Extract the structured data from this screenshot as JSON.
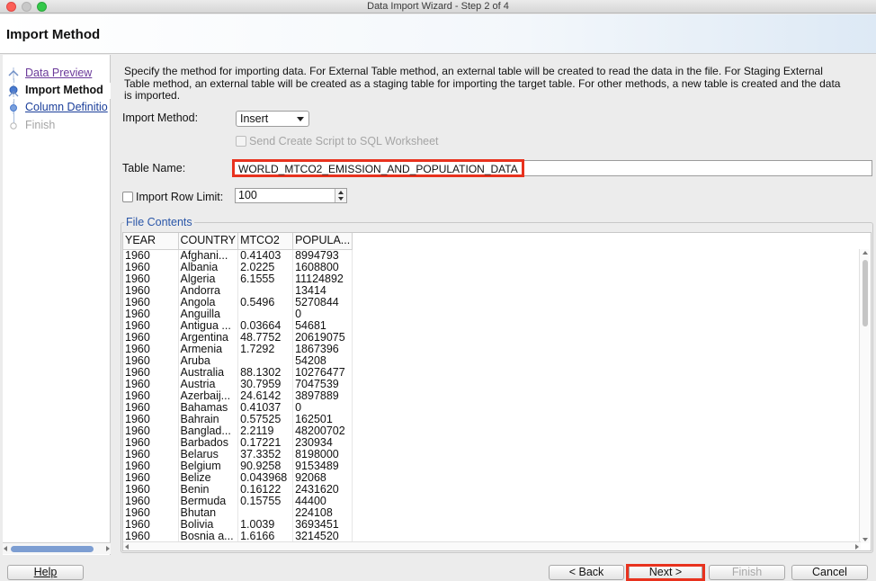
{
  "window": {
    "title": "Data Import Wizard - Step 2 of 4"
  },
  "header": {
    "title": "Import Method"
  },
  "steps": [
    {
      "label": "Data Preview",
      "state": "visited"
    },
    {
      "label": "Import Method",
      "state": "current"
    },
    {
      "label": "Column Definitio",
      "state": "link"
    },
    {
      "label": "Finish",
      "state": "disabled"
    }
  ],
  "description": "Specify the method for importing data.  For External Table method, an external table will be created to read the data in the file.  For Staging External Table method, an external table will be created as a staging table for importing the target table.  For other methods, a new table is created and the data is imported.",
  "form": {
    "import_method_label": "Import Method:",
    "import_method_value": "Insert",
    "send_script_label": "Send Create Script to SQL Worksheet",
    "table_name_label": "Table Name:",
    "table_name_value": "WORLD_MTCO2_EMISSION_AND_POPULATION_DATA",
    "import_row_limit_label": "Import Row Limit:",
    "import_row_limit_value": "100"
  },
  "file_contents": {
    "title": "File Contents",
    "columns": [
      "YEAR",
      "COUNTRY",
      "MTCO2",
      "POPULA..."
    ],
    "rows": [
      [
        "1960",
        "Afghani...",
        "0.41403",
        "8994793"
      ],
      [
        "1960",
        "Albania",
        "2.0225",
        "1608800"
      ],
      [
        "1960",
        "Algeria",
        "6.1555",
        "11124892"
      ],
      [
        "1960",
        "Andorra",
        "",
        "13414"
      ],
      [
        "1960",
        "Angola",
        "0.5496",
        "5270844"
      ],
      [
        "1960",
        "Anguilla",
        "",
        "0"
      ],
      [
        "1960",
        "Antigua ...",
        "0.03664",
        "54681"
      ],
      [
        "1960",
        "Argentina",
        "48.7752",
        "20619075"
      ],
      [
        "1960",
        "Armenia",
        "1.7292",
        "1867396"
      ],
      [
        "1960",
        "Aruba",
        "",
        "54208"
      ],
      [
        "1960",
        "Australia",
        "88.1302",
        "10276477"
      ],
      [
        "1960",
        "Austria",
        "30.7959",
        "7047539"
      ],
      [
        "1960",
        "Azerbaij...",
        "24.6142",
        "3897889"
      ],
      [
        "1960",
        "Bahamas",
        "0.41037",
        "0"
      ],
      [
        "1960",
        "Bahrain",
        "0.57525",
        "162501"
      ],
      [
        "1960",
        "Banglad...",
        "2.2119",
        "48200702"
      ],
      [
        "1960",
        "Barbados",
        "0.17221",
        "230934"
      ],
      [
        "1960",
        "Belarus",
        "37.3352",
        "8198000"
      ],
      [
        "1960",
        "Belgium",
        "90.9258",
        "9153489"
      ],
      [
        "1960",
        "Belize",
        "0.043968",
        "92068"
      ],
      [
        "1960",
        "Benin",
        "0.16122",
        "2431620"
      ],
      [
        "1960",
        "Bermuda",
        "0.15755",
        "44400"
      ],
      [
        "1960",
        "Bhutan",
        "",
        "224108"
      ],
      [
        "1960",
        "Bolivia",
        "1.0039",
        "3693451"
      ],
      [
        "1960",
        "Bosnia a...",
        "1.6166",
        "3214520"
      ]
    ]
  },
  "buttons": {
    "help": "Help",
    "back": "< Back",
    "next": "Next >",
    "finish": "Finish",
    "cancel": "Cancel"
  },
  "colors": {
    "highlight": "#e8321e",
    "link": "#1a3e9a"
  }
}
